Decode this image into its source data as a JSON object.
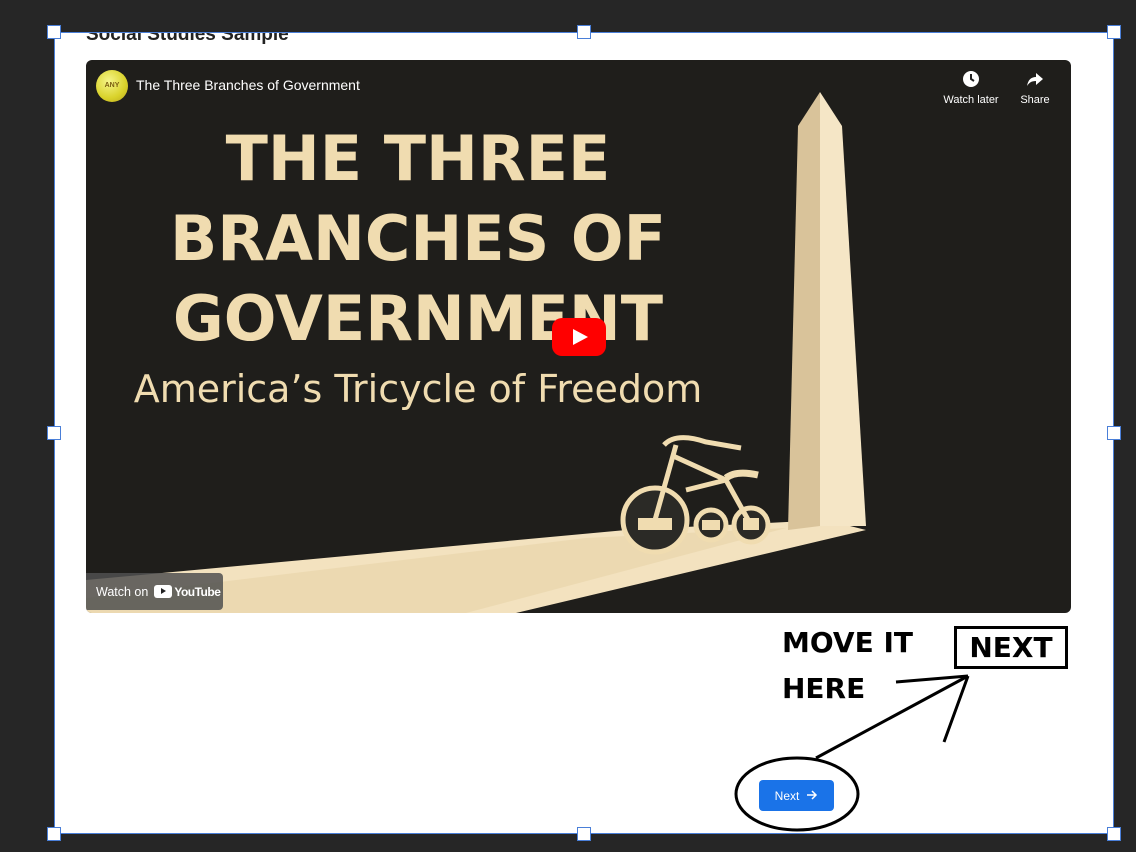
{
  "section_title": "Social Studies Sample",
  "video": {
    "channel_avatar_text": "ANY BALL AHEAD",
    "title": "The Three Branches of Government",
    "watch_later_label": "Watch later",
    "share_label": "Share",
    "watch_on_label": "Watch on",
    "youtube_label": "YouTube",
    "thumbnail": {
      "heading_lines": [
        "THE THREE",
        "BRANCHES OF",
        "GOVERNMENT"
      ],
      "subtitle": "America’s Tricycle of Freedom"
    }
  },
  "annotation": {
    "line1": "MOVE IT",
    "line2": "HERE",
    "box_label": "NEXT"
  },
  "next_button": {
    "label": "Next"
  },
  "colors": {
    "editor_background": "#262626",
    "selection": "#4a7fd8",
    "button_primary": "#1a73e8",
    "youtube_red": "#ff0000",
    "thumbnail_text": "#f0dcb0"
  }
}
